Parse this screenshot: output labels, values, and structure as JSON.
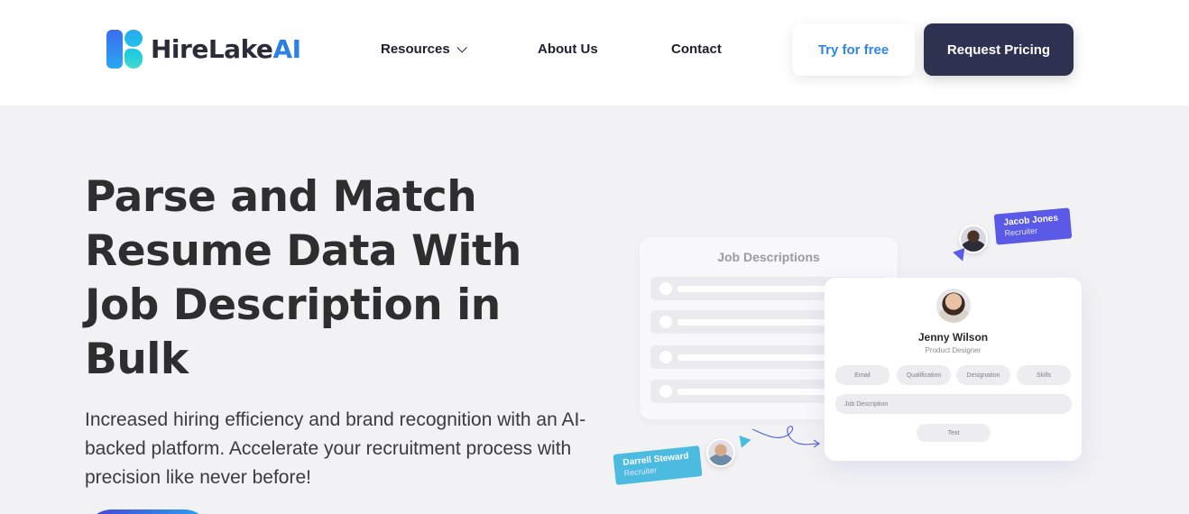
{
  "header": {
    "logo": {
      "text_main": "HireLake",
      "text_accent": "AI"
    },
    "nav": {
      "resources": "Resources",
      "about": "About Us",
      "contact": "Contact"
    },
    "try_free": "Try for free",
    "request_pricing": "Request Pricing"
  },
  "hero": {
    "title": "Parse and Match Resume Data With Job Description in Bulk",
    "subtitle": "Increased hiring efficiency and brand recognition with an AI-backed platform. Accelerate your recruitment process with precision like never before!"
  },
  "illustration": {
    "job_descriptions_title": "Job Descriptions",
    "profile": {
      "name": "Jenny Wilson",
      "role": "Product Designer",
      "chips": [
        "Email",
        "Qualification",
        "Designation",
        "Skills"
      ],
      "job_description_field": "Job Description",
      "text_button": "Text"
    },
    "tag_top": {
      "name": "Jacob Jones",
      "role": "Recruiter"
    },
    "tag_bottom": {
      "name": "Darrell Steward",
      "role": "Recruiter"
    }
  },
  "colors": {
    "primary_dark": "#2f3150",
    "link_blue": "#2e86e6",
    "hero_bg": "#f2f2f4",
    "tag_purple": "#5a5ae6",
    "tag_cyan": "#4bbbe0"
  }
}
